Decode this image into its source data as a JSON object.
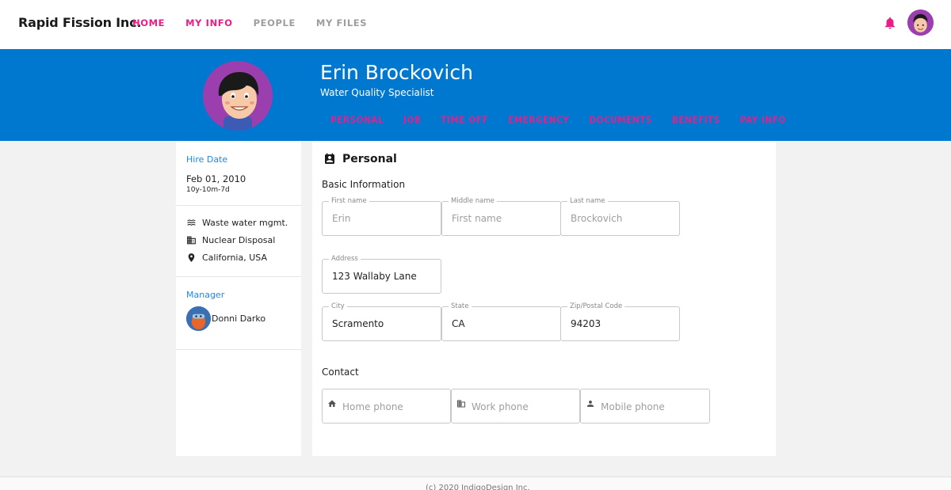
{
  "app": {
    "brand": "Rapid Fission Inc."
  },
  "nav": [
    {
      "label": "HOME",
      "active": true
    },
    {
      "label": "MY INFO",
      "active": true
    },
    {
      "label": "PEOPLE",
      "active": false
    },
    {
      "label": "MY FILES",
      "active": false
    }
  ],
  "profile": {
    "name": "Erin Brockovich",
    "title": "Water Quality Specialist",
    "tabs": [
      "PERSONAL",
      "JOB",
      "TIME OFF",
      "EMERGENCY",
      "DOCUMENTS",
      "BENEFITS",
      "PAY INFO"
    ]
  },
  "sidebar": {
    "hire_label": "Hire Date",
    "hire_date": "Feb 01, 2010",
    "tenure": "10y-10m-7d",
    "department": "Waste water mgmt.",
    "division": "Nuclear Disposal",
    "location": "California, USA",
    "manager_label": "Manager",
    "manager_name": "Donni Darko"
  },
  "personal": {
    "section_title": "Personal",
    "basic_heading": "Basic Information",
    "first_name": {
      "label": "First name",
      "value": "Erin"
    },
    "middle_name": {
      "label": "Middle name",
      "placeholder": "First name"
    },
    "last_name": {
      "label": "Last name",
      "value": "Brockovich"
    },
    "address": {
      "label": "Address",
      "value": "123 Wallaby Lane"
    },
    "city": {
      "label": "City",
      "value": "Scramento"
    },
    "state": {
      "label": "State",
      "value": "CA"
    },
    "zip": {
      "label": "Zip/Postal Code",
      "value": "94203"
    },
    "contact_heading": "Contact",
    "home_phone": {
      "placeholder": "Home phone"
    },
    "work_phone": {
      "placeholder": "Work phone"
    },
    "mobile_phone": {
      "placeholder": "Mobile phone"
    }
  },
  "footer": {
    "text": "(c) 2020 IndigoDesign Inc."
  },
  "colors": {
    "accent": "#e91e86",
    "header_bg": "#0078d0",
    "link_blue": "#1e88e5"
  }
}
